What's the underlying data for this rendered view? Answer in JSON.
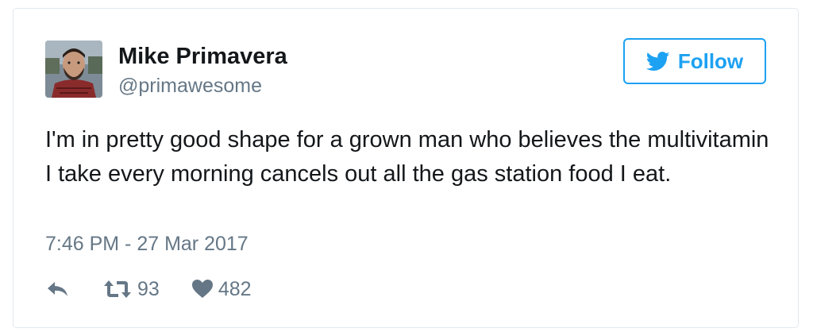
{
  "tweet": {
    "author": {
      "name": "Mike Primavera",
      "handle": "@primawesome",
      "avatar_icon": "profile-photo"
    },
    "follow_button": {
      "label": "Follow",
      "icon": "twitter-bird-icon"
    },
    "text": "I'm in pretty good shape for a grown man who believes the multivitamin I take every morning cancels out all the gas station food I eat.",
    "timestamp": "7:46 PM - 27 Mar 2017",
    "actions": {
      "reply": {
        "icon": "reply-icon"
      },
      "retweet": {
        "icon": "retweet-icon",
        "count": "93"
      },
      "like": {
        "icon": "heart-icon",
        "count": "482"
      }
    }
  },
  "colors": {
    "accent": "#1da1f2",
    "text": "#14171a",
    "secondary": "#657786",
    "border": "#e1e8ed"
  }
}
